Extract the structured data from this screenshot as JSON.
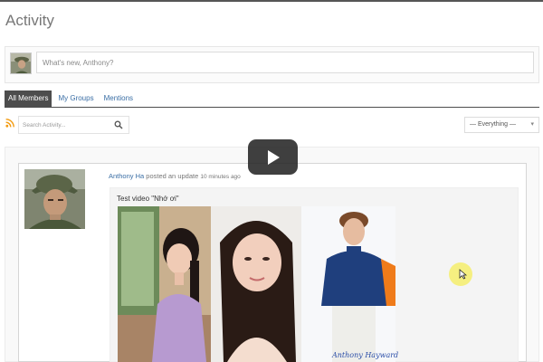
{
  "page": {
    "title": "Activity"
  },
  "post_form": {
    "placeholder": "What's new, Anthony?"
  },
  "tabs": [
    {
      "label": "All Members",
      "active": true
    },
    {
      "label": "My Groups",
      "active": false
    },
    {
      "label": "Mentions",
      "active": false
    }
  ],
  "search": {
    "placeholder": "Search Activity..."
  },
  "filter": {
    "selected": "— Everything —"
  },
  "activity": {
    "user": "Anthony Ha",
    "action": " posted an update ",
    "time": "10 minutes ago",
    "video_title": "Test video \"Nhớ ơi\"",
    "signature": "Anthony Hayward"
  },
  "icons": {
    "rss": "rss-icon",
    "search": "search-icon",
    "play": "play-icon",
    "cursor": "cursor-icon"
  },
  "colors": {
    "link": "#3a6ea5",
    "tab_active_bg": "#4d4d4d",
    "play_bg": "#212121",
    "rss": "#f39c12",
    "cursor_highlight": "#f6ee5a"
  }
}
